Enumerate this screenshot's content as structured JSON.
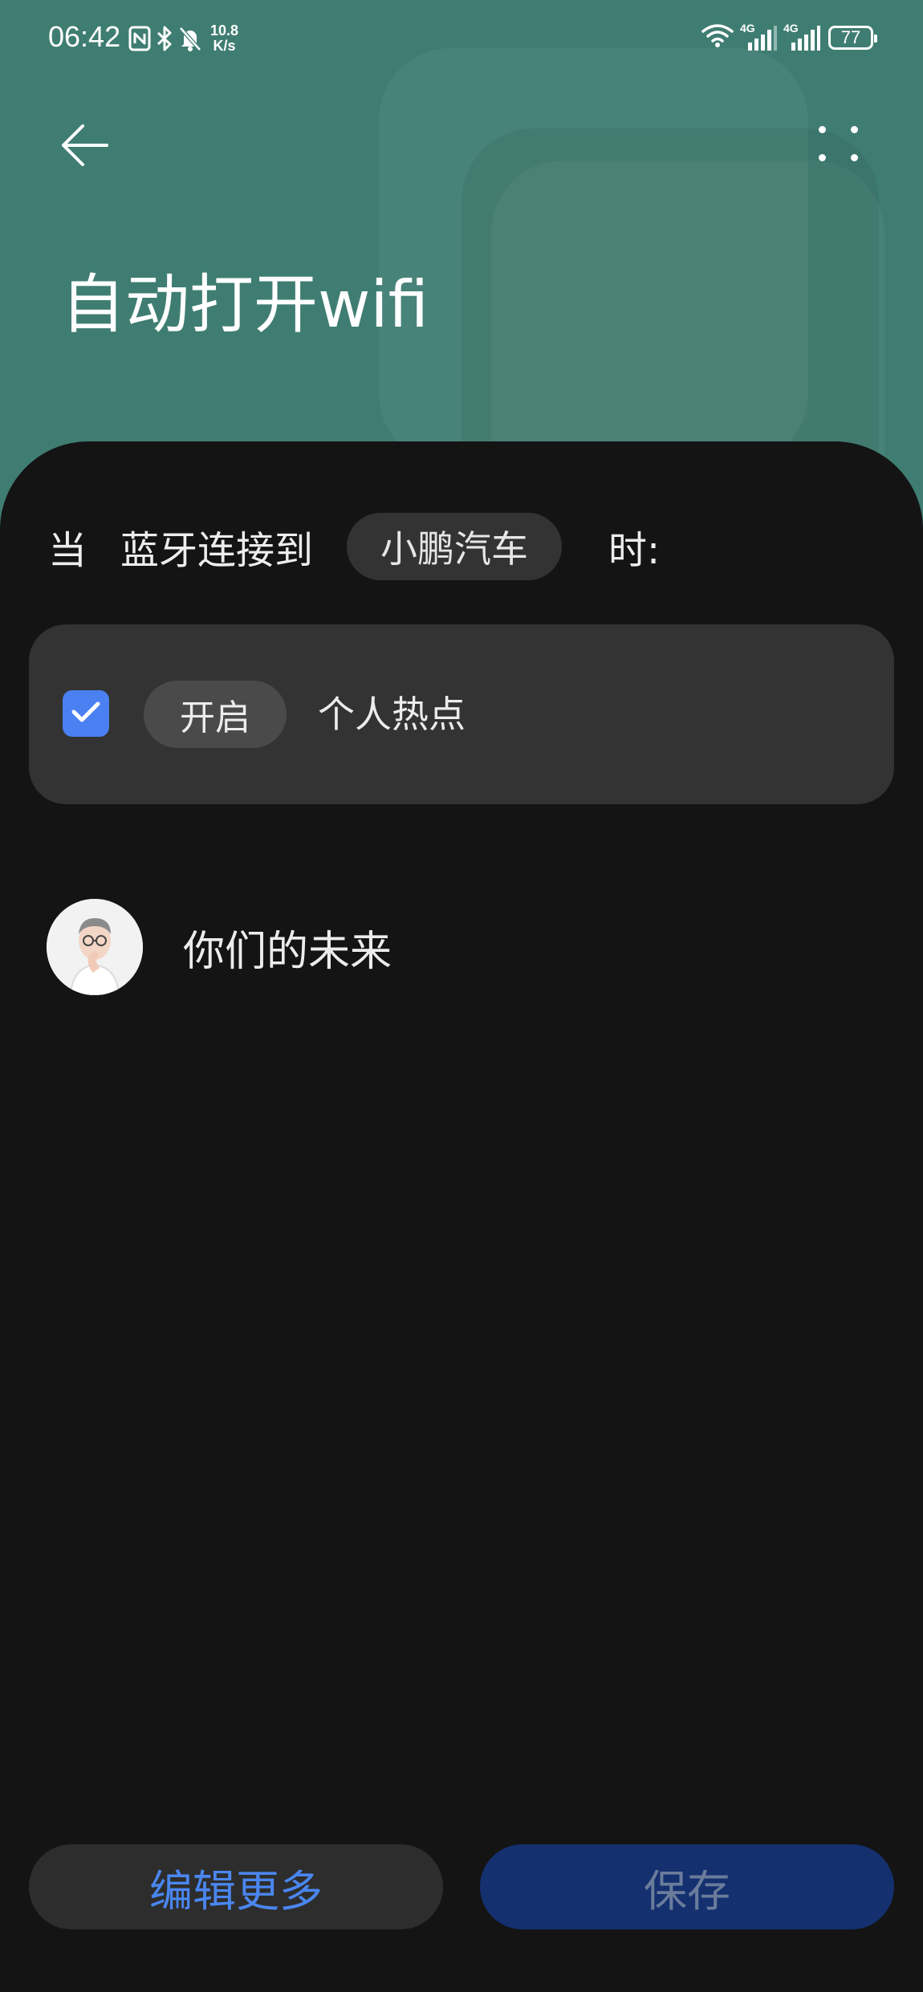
{
  "status_bar": {
    "time": "06:42",
    "net_speed_value": "10.8",
    "net_speed_unit": "K/s",
    "signal_1_label": "4G",
    "signal_2_label": "4G",
    "battery": "77",
    "icons": [
      "nfc-icon",
      "bluetooth-icon",
      "mute-bell-icon",
      "wifi-icon",
      "signal-icon",
      "signal-icon",
      "battery-icon"
    ]
  },
  "header": {
    "title": "自动打开wifi",
    "back_icon": "back-arrow-icon",
    "more_icon": "more-dots-icon",
    "color": "#3f7d72"
  },
  "condition": {
    "when": "当",
    "trigger": "蓝牙连接到",
    "device": "小鹏汽车",
    "suffix": "时:"
  },
  "action": {
    "checked": true,
    "verb": "开启",
    "target": "个人热点",
    "accent": "#4a80f2"
  },
  "profile": {
    "name": "你们的未来"
  },
  "footer": {
    "edit_label": "编辑更多",
    "save_label": "保存",
    "edit_color": "#4a86f0",
    "save_bg": "#14306f"
  }
}
